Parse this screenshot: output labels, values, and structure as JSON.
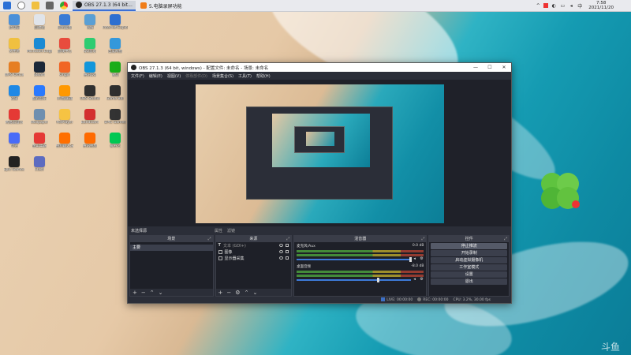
{
  "taskbar": {
    "tasks": [
      {
        "label": "OBS 27.1.3 (64 bit...",
        "active": true
      },
      {
        "label": "5.电脑录屏功能",
        "active": false
      }
    ],
    "clock_time": "7:58",
    "clock_date": "2021/11/20"
  },
  "desktop_icons": [
    "此电脑",
    "回收站",
    "控制面板",
    "网络",
    "Internet Explorer",
    "文件夹",
    "Microsoft Edge",
    "游戏中心",
    "QQ音乐",
    "百度网盘",
    "WPS Office",
    "Steam",
    "Origin",
    "腾讯QQ",
    "微信",
    "迅雷",
    "酷狗音乐",
    "UU加速器",
    "OBS Studio",
    "Game Bar",
    "网易云音乐",
    "Wallpaper",
    "PotPlayer",
    "Bandicam",
    "EPIC Games",
    "夸克",
    "金山毒霸",
    "搜狗输入法",
    "腾讯视频",
    "爱奇艺",
    "Epic Games",
    "Clash"
  ],
  "obs": {
    "title": "OBS 27.1.3 (64 bit, windows) - 配置文件: 未命名 - 场景: 未命名",
    "menu": [
      "文件(F)",
      "编辑(E)",
      "视图(V)",
      "停靠部件(D)",
      "场景集合(S)",
      "工具(T)",
      "帮助(H)"
    ],
    "scene_bar_label": "未选择源",
    "scene_bar_actions": [
      "属性",
      "滤镜"
    ],
    "docks": {
      "scenes_title": "场景",
      "scenes": [
        "主要"
      ],
      "sources_title": "来源",
      "sources": [
        "文本 (GDI+)",
        "图像",
        "显示器采集"
      ],
      "mixer_title": "混音器",
      "mixer": [
        {
          "name": "麦克风/Aux",
          "level": "0.0 dB",
          "fader_fraction": 0.98
        },
        {
          "name": "桌面音频",
          "level": "-8.0 dB",
          "fader_fraction": 0.7
        }
      ],
      "controls_title": "控件",
      "controls": [
        "停止推流",
        "开始录制",
        "启动虚拟摄像机",
        "工作室模式",
        "设置",
        "退出"
      ]
    },
    "status": {
      "live": "LIVE: 00:00:00",
      "rec": "REC: 00:00:00",
      "cpu": "CPU: 3.2%, 30.00 fps"
    }
  },
  "watermark": "斗鱼"
}
